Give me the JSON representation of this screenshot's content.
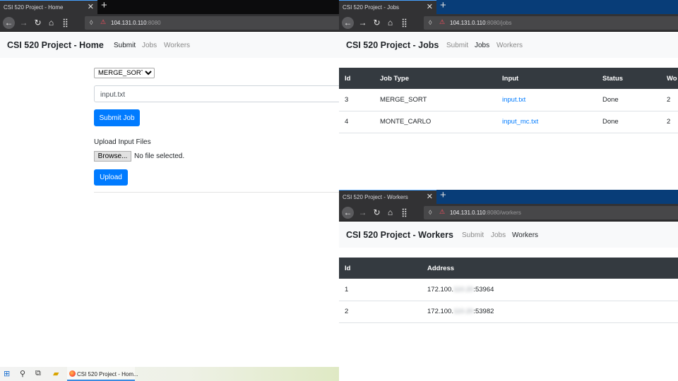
{
  "windows": {
    "home": {
      "tab_title": "CSI 520 Project - Home",
      "url_host": "104.131.0.110",
      "url_rest": ":8080",
      "brand": "CSI 520 Project - Home",
      "nav": {
        "submit": "Submit",
        "jobs": "Jobs",
        "workers": "Workers"
      },
      "active_nav": "Submit",
      "job_type_selected": "MERGE_SORT",
      "input_value": "input.txt",
      "submit_button": "Submit Job",
      "upload_label": "Upload Input Files",
      "browse_button": "Browse...",
      "file_status": "No file selected.",
      "upload_button": "Upload"
    },
    "jobs": {
      "tab_title": "CSI 520 Project - Jobs",
      "url_host": "104.131.0.110",
      "url_rest": ":8080/jobs",
      "brand": "CSI 520 Project - Jobs",
      "nav": {
        "submit": "Submit",
        "jobs": "Jobs",
        "workers": "Workers"
      },
      "active_nav": "Jobs",
      "table": {
        "headers": [
          "Id",
          "Job Type",
          "Input",
          "Status",
          "Wo"
        ],
        "rows": [
          [
            "3",
            "MERGE_SORT",
            "input.txt",
            "Done",
            "2"
          ],
          [
            "4",
            "MONTE_CARLO",
            "input_mc.txt",
            "Done",
            "2"
          ]
        ]
      }
    },
    "workers": {
      "tab_title": "CSI 520 Project - Workers",
      "url_host": "104.131.0.110",
      "url_rest": ":8080/workers",
      "brand": "CSI 520 Project - Workers",
      "nav": {
        "submit": "Submit",
        "jobs": "Jobs",
        "workers": "Workers"
      },
      "active_nav": "Workers",
      "table": {
        "headers": [
          "Id",
          "Address"
        ],
        "rows": [
          {
            "id": "1",
            "addr_prefix": "172.100.",
            "addr_hidden": "110.20",
            "addr_suffix": ":53964"
          },
          {
            "id": "2",
            "addr_prefix": "172.100.",
            "addr_hidden": "110.20",
            "addr_suffix": ":53982"
          }
        ]
      }
    }
  },
  "taskbar": {
    "app_label": "CSI 520 Project - Hom..."
  },
  "colors": {
    "primary": "#007bff",
    "table_head": "#343a40",
    "navbar": "#f8f9fa",
    "chrome": "#323234",
    "link": "#007bff"
  }
}
